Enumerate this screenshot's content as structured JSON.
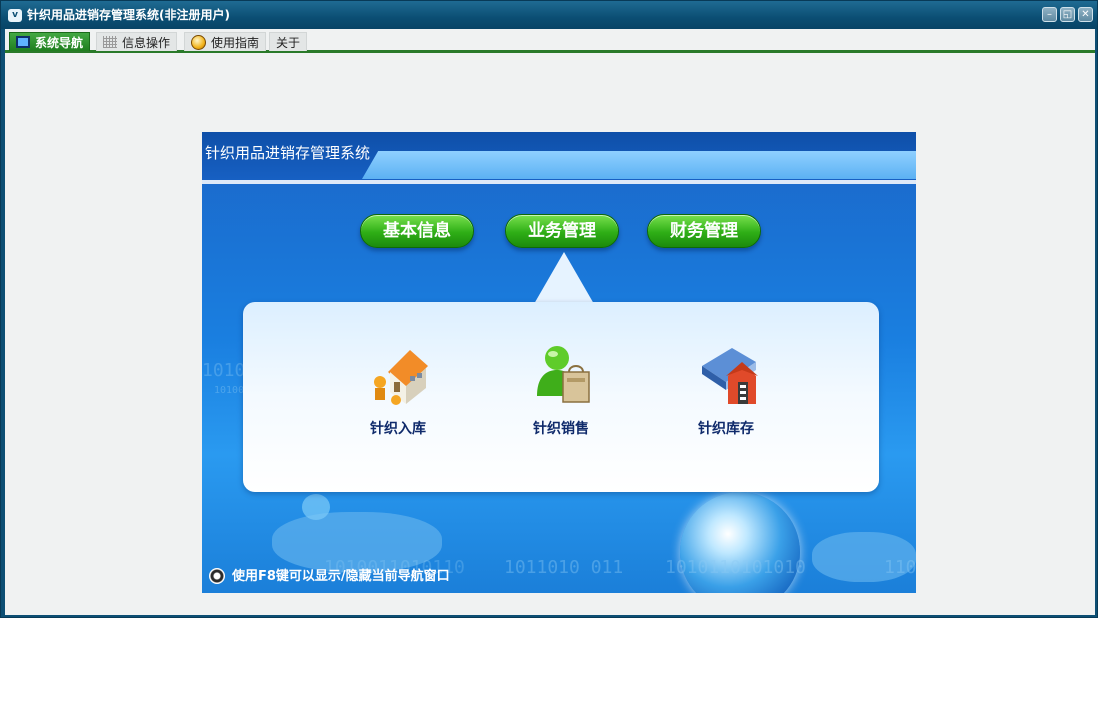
{
  "window": {
    "title": "针织用品进销存管理系统(非注册用户)",
    "controls": {
      "minimize": "–",
      "restore": "◱",
      "close": "✕"
    }
  },
  "tabs": [
    {
      "label": "系统导航",
      "icon": "monitor-icon",
      "active": true
    },
    {
      "label": "信息操作",
      "icon": "grid-icon",
      "active": false
    },
    {
      "label": "使用指南",
      "icon": "guide-icon",
      "active": false
    },
    {
      "label": "关于",
      "icon": "",
      "active": false
    }
  ],
  "nav": {
    "title": "针织用品进销存管理系统",
    "categories": [
      "基本信息",
      "业务管理",
      "财务管理"
    ],
    "selected_category": "业务管理",
    "items": [
      {
        "label": "针织入库",
        "icon": "warehouse-in-icon"
      },
      {
        "label": "针织销售",
        "icon": "shopping-person-icon"
      },
      {
        "label": "针织库存",
        "icon": "inventory-book-icon"
      }
    ],
    "hint": "使用F8键可以显示/隐藏当前导航窗口",
    "decorations": {
      "binary_left_top": "1010",
      "binary_left_small": "10100",
      "binary_bottom_1": "1010011010110",
      "binary_bottom_2": "1011010  011",
      "binary_bottom_3": "1010110101010",
      "binary_bottom_4": "110"
    }
  },
  "colors": {
    "title_bar": "#0b4e73",
    "tab_active": "#2e8f2e",
    "pill_green": "#2eae16",
    "nav_blue": "#1a7fe0",
    "label_dark_blue": "#0f2a6b"
  }
}
